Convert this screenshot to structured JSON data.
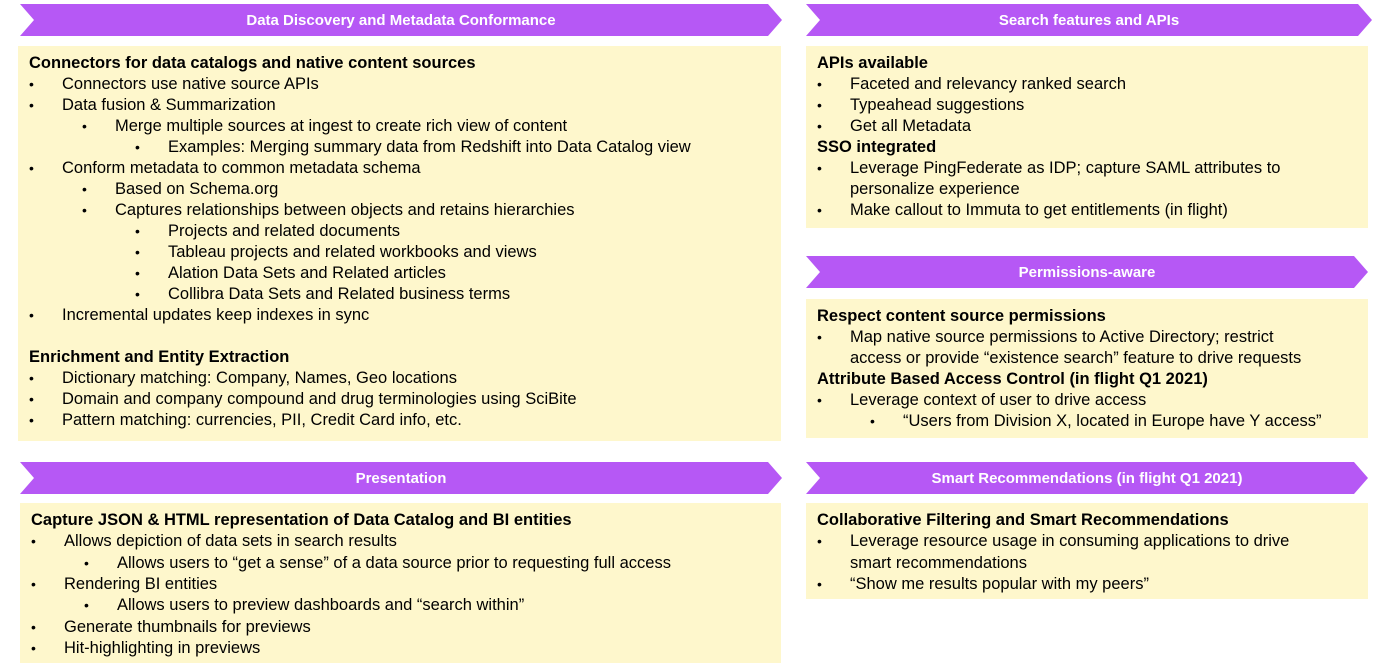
{
  "colors": {
    "banner": "#b658f5",
    "panel": "#fef7cc",
    "bullet_glyph": "•"
  },
  "sections": {
    "discovery": {
      "title": "Data Discovery and Metadata Conformance",
      "lines": [
        {
          "kind": "h",
          "text": "Connectors for data catalogs and native content sources"
        },
        {
          "kind": "b",
          "level": 1,
          "text": "Connectors use native source APIs"
        },
        {
          "kind": "b",
          "level": 1,
          "text": "Data fusion & Summarization"
        },
        {
          "kind": "b",
          "level": 2,
          "text": "Merge multiple sources at ingest to create rich view of content"
        },
        {
          "kind": "b",
          "level": 3,
          "text": "Examples: Merging summary data from Redshift into Data Catalog view"
        },
        {
          "kind": "b",
          "level": 1,
          "text": "Conform metadata to common metadata schema"
        },
        {
          "kind": "b",
          "level": 2,
          "text": "Based on Schema.org"
        },
        {
          "kind": "b",
          "level": 2,
          "text": "Captures relationships between objects and retains hierarchies"
        },
        {
          "kind": "b",
          "level": 3,
          "text": "Projects and related documents"
        },
        {
          "kind": "b",
          "level": 3,
          "text": "Tableau projects and related workbooks and views"
        },
        {
          "kind": "b",
          "level": 3,
          "text": "Alation Data Sets and Related articles"
        },
        {
          "kind": "b",
          "level": 3,
          "text": "Collibra Data Sets and Related business terms"
        },
        {
          "kind": "b",
          "level": 1,
          "text": "Incremental updates keep indexes in sync"
        },
        {
          "kind": "gap"
        },
        {
          "kind": "h",
          "text": "Enrichment and Entity Extraction"
        },
        {
          "kind": "b",
          "level": 1,
          "text": "Dictionary matching: Company, Names, Geo locations"
        },
        {
          "kind": "b",
          "level": 1,
          "text": "Domain and company compound and drug terminologies using SciBite"
        },
        {
          "kind": "b",
          "level": 1,
          "text": "Pattern matching: currencies, PII, Credit Card info, etc."
        }
      ]
    },
    "search": {
      "title": "Search features and APIs",
      "lines": [
        {
          "kind": "h",
          "text": "APIs available"
        },
        {
          "kind": "b",
          "level": 1,
          "text": "Faceted and relevancy ranked search"
        },
        {
          "kind": "b",
          "level": 1,
          "text": "Typeahead suggestions"
        },
        {
          "kind": "b",
          "level": 1,
          "text": "Get all Metadata"
        },
        {
          "kind": "h",
          "text": "SSO integrated"
        },
        {
          "kind": "b",
          "level": 1,
          "text": "Leverage PingFederate as IDP; capture SAML attributes to"
        },
        {
          "kind": "c",
          "level": 1,
          "text": "personalize experience"
        },
        {
          "kind": "b",
          "level": 1,
          "text": "Make callout to Immuta to get entitlements (in flight)"
        }
      ]
    },
    "permissions": {
      "title": "Permissions-aware",
      "lines": [
        {
          "kind": "h",
          "text": "Respect content source permissions"
        },
        {
          "kind": "b",
          "level": 1,
          "text": "Map native source permissions to Active Directory; restrict"
        },
        {
          "kind": "c",
          "level": 1,
          "text": "access or provide “existence search” feature to drive requests"
        },
        {
          "kind": "h",
          "text": "Attribute Based Access Control (in flight Q1 2021)"
        },
        {
          "kind": "b",
          "level": 1,
          "text": "Leverage context of user to drive access"
        },
        {
          "kind": "b",
          "level": 2,
          "text": "“Users from Division X, located in Europe have Y access”"
        }
      ]
    },
    "presentation": {
      "title": "Presentation",
      "lines": [
        {
          "kind": "h",
          "text": "Capture JSON & HTML representation of Data Catalog and BI entities"
        },
        {
          "kind": "b",
          "level": 1,
          "text": "Allows depiction of data sets in search results"
        },
        {
          "kind": "b",
          "level": 2,
          "text": "Allows users to “get a sense” of a data source prior to requesting full access"
        },
        {
          "kind": "b",
          "level": 1,
          "text": "Rendering BI entities"
        },
        {
          "kind": "b",
          "level": 2,
          "text": "Allows users to preview dashboards and “search within”"
        },
        {
          "kind": "b",
          "level": 1,
          "text": "Generate thumbnails for previews"
        },
        {
          "kind": "b",
          "level": 1,
          "text": "Hit-highlighting in previews"
        }
      ]
    },
    "smart": {
      "title": "Smart Recommendations (in flight Q1 2021)",
      "lines": [
        {
          "kind": "h",
          "text": "Collaborative Filtering and Smart Recommendations"
        },
        {
          "kind": "b",
          "level": 1,
          "text": "Leverage resource usage in consuming applications to drive"
        },
        {
          "kind": "c",
          "level": 1,
          "text": "smart recommendations"
        },
        {
          "kind": "b",
          "level": 1,
          "text": "“Show me results popular with my peers”"
        }
      ]
    }
  }
}
